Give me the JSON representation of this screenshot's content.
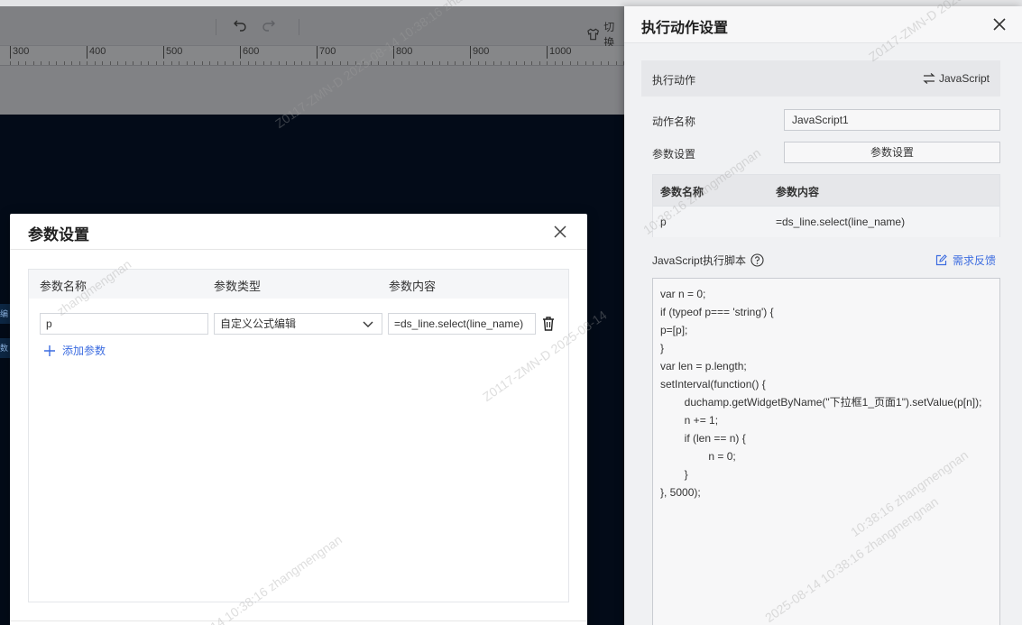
{
  "editor": {
    "switch_label": "切换",
    "ruler_marks": [
      "300",
      "400",
      "500",
      "600",
      "700",
      "800",
      "900",
      "1000"
    ],
    "side_chips": [
      "编",
      "数"
    ]
  },
  "modal": {
    "title": "参数设置",
    "columns": [
      "参数名称",
      "参数类型",
      "参数内容"
    ],
    "row": {
      "name": "p",
      "type": "自定义公式编辑",
      "content": "=ds_line.select(line_name)"
    },
    "add_label": "添加参数"
  },
  "panel": {
    "title": "执行动作设置",
    "action_label": "执行动作",
    "action_type": "JavaScript",
    "name_label": "动作名称",
    "name_value": "JavaScript1",
    "params_label": "参数设置",
    "params_button": "参数设置",
    "table_headers": [
      "参数名称",
      "参数内容"
    ],
    "table_row": [
      "p",
      "=ds_line.select(line_name)"
    ],
    "script_label": "JavaScript执行脚本",
    "feedback_label": "需求反馈",
    "script": "var n = 0;\nif (typeof p=== 'string') {\np=[p];\n}\nvar len = p.length;\nsetInterval(function() {\n        duchamp.getWidgetByName(\"下拉框1_页面1\").setValue(p[n]);\n        n += 1;\n        if (len == n) {\n                n = 0;\n        }\n}, 5000);"
  },
  "watermarks": [
    "Z0117-ZMN-D 2025-08-14 10:38:16 zhangmengnan",
    "zhangmengnan",
    "10:38:16 zhangmengnan",
    "Z0117-ZMN-D 2025-08-14",
    "14 10:38:16 zhangmengnan",
    "2025-08-14 10:38:16 zhangmengnan",
    "Z0117-ZMN-D 2025-08-14",
    "10:38:16 zhangmengnan"
  ]
}
